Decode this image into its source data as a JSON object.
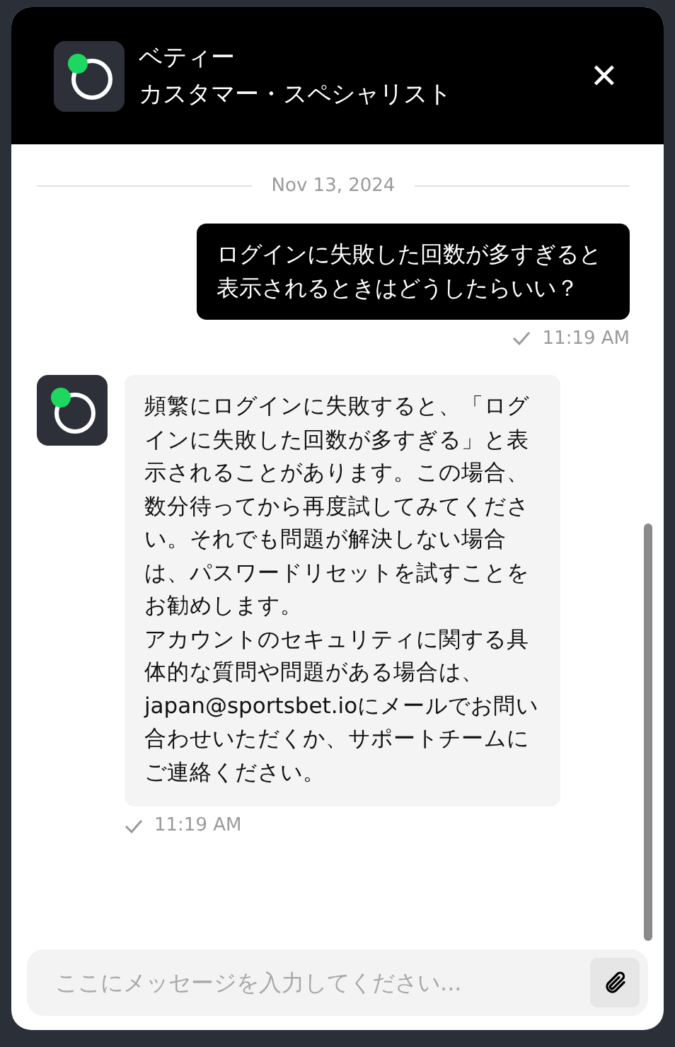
{
  "header": {
    "name": "ベティー",
    "role": "カスタマー・スペシャリスト",
    "close": "✕"
  },
  "date_divider": "Nov 13, 2024",
  "messages": [
    {
      "kind": "user",
      "text": "ログインに失敗した回数が多すぎると表示されるときはどうしたらいい？",
      "time": "11:19 AM"
    },
    {
      "kind": "agent",
      "paragraphs": [
        "頻繁にログインに失敗すると、「ログインに失敗した回数が多すぎる」と表示されることがあります。この場合、数分待ってから再度試してみてください。それでも問題が解決しない場合は、パスワードリセットを試すことをお勧めします。",
        "アカウントのセキュリティに関する具体的な質問や問題がある場合は、japan@sportsbet.ioにメールでお問い合わせいただくか、サポートチームにご連絡ください。"
      ],
      "time": "11:19 AM"
    }
  ],
  "composer": {
    "placeholder": "ここにメッセージを入力してください..."
  }
}
